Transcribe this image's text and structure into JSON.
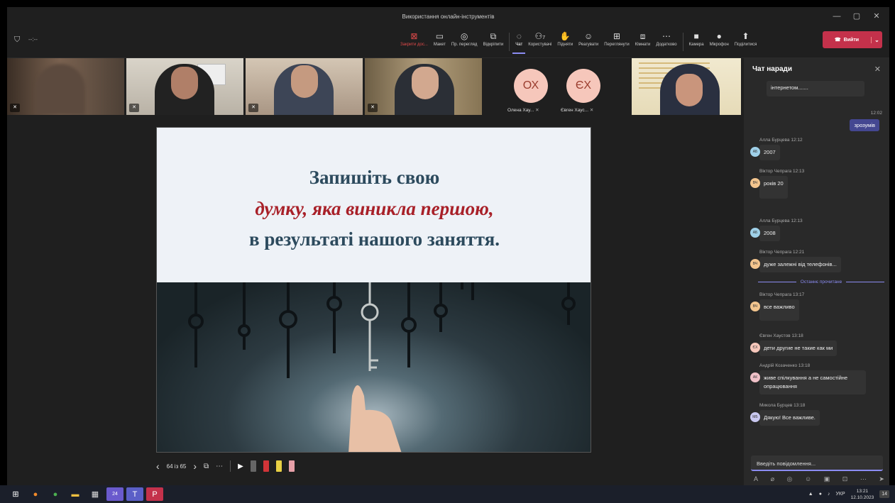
{
  "window": {
    "title": "Використання онлайн-інструментів",
    "minimize_icon": "—",
    "maximize_icon": "▢",
    "close_icon": "✕"
  },
  "meeting": {
    "timer": "--:--"
  },
  "toolbar": {
    "items": [
      {
        "label": "Закрити дос...",
        "icon": "⊠"
      },
      {
        "label": "Макет",
        "icon": "▭"
      },
      {
        "label": "Пр. перегляд",
        "icon": "◎"
      },
      {
        "label": "Відкріпити",
        "icon": "⧉"
      },
      {
        "label": "Чат",
        "icon": "◌"
      },
      {
        "label": "Користувачі",
        "icon": "⚇",
        "count": "7"
      },
      {
        "label": "Підняти",
        "icon": "✋"
      },
      {
        "label": "Реагувати",
        "icon": "☺"
      },
      {
        "label": "Переглянути",
        "icon": "⊞"
      },
      {
        "label": "Кімнати",
        "icon": "⧈"
      },
      {
        "label": "Додатково",
        "icon": "⋯"
      },
      {
        "label": "Камера",
        "icon": "■"
      },
      {
        "label": "Мікрофон",
        "icon": "🎙"
      },
      {
        "label": "Поділитися",
        "icon": "⬆"
      }
    ],
    "leave_label": "Вийти",
    "leave_dropdown": "⌄"
  },
  "participants": [
    {
      "initials": "ОХ",
      "name": "Олена Хау..."
    },
    {
      "initials": "ЄХ",
      "name": "Євген Хаус..."
    }
  ],
  "slide": {
    "line1": "Запишіть свою",
    "line2": "думку, яка виникла першою,",
    "line3": "в результаті нашого заняття.",
    "counter": "64 із 65",
    "prev_icon": "‹",
    "next_icon": "›",
    "grid_icon": "⧉",
    "more_icon": "⋯",
    "pointer_icon": "▶"
  },
  "chat": {
    "title": "Чат наради",
    "close_icon": "✕",
    "own_truncated": "інтернетом.......",
    "own_time": "12:02",
    "own_message": "зрозумів",
    "messages": [
      {
        "sender": "Алла Бурцева  12:12",
        "initials": "АБ",
        "text": "2007"
      },
      {
        "sender": "Віктор Чепрага  12:13",
        "initials": "ВЧ",
        "text": "років 20"
      },
      {
        "sender": "Алла Бурцева  12:13",
        "initials": "АБ",
        "text": "2008"
      },
      {
        "sender": "Віктор Чепрага  12:21",
        "initials": "ВЧ",
        "text": "дуже залежні від телефонів..."
      },
      {
        "sender": "Віктор Чепрага  13:17",
        "initials": "ВЧ",
        "text": "все важливо"
      },
      {
        "sender": "Євген Хаустов  13:18",
        "initials": "ЄХ",
        "text": "дети другие не такие как ми"
      },
      {
        "sender": "Андрій Козаченко  13:18",
        "initials": "АК",
        "text": "живе спілкування а не самостійне опрацювання"
      },
      {
        "sender": "Микола Бурцев  13:18",
        "initials": "МБ",
        "text": "Дякую! Все важливе."
      }
    ],
    "last_read": "Останнє прочитане",
    "compose_placeholder": "Введіть повідомлення..."
  },
  "taskbar": {
    "language": "УКР",
    "time": "13:21",
    "date": "12.10.2023",
    "badge": "24",
    "notif": "14"
  }
}
